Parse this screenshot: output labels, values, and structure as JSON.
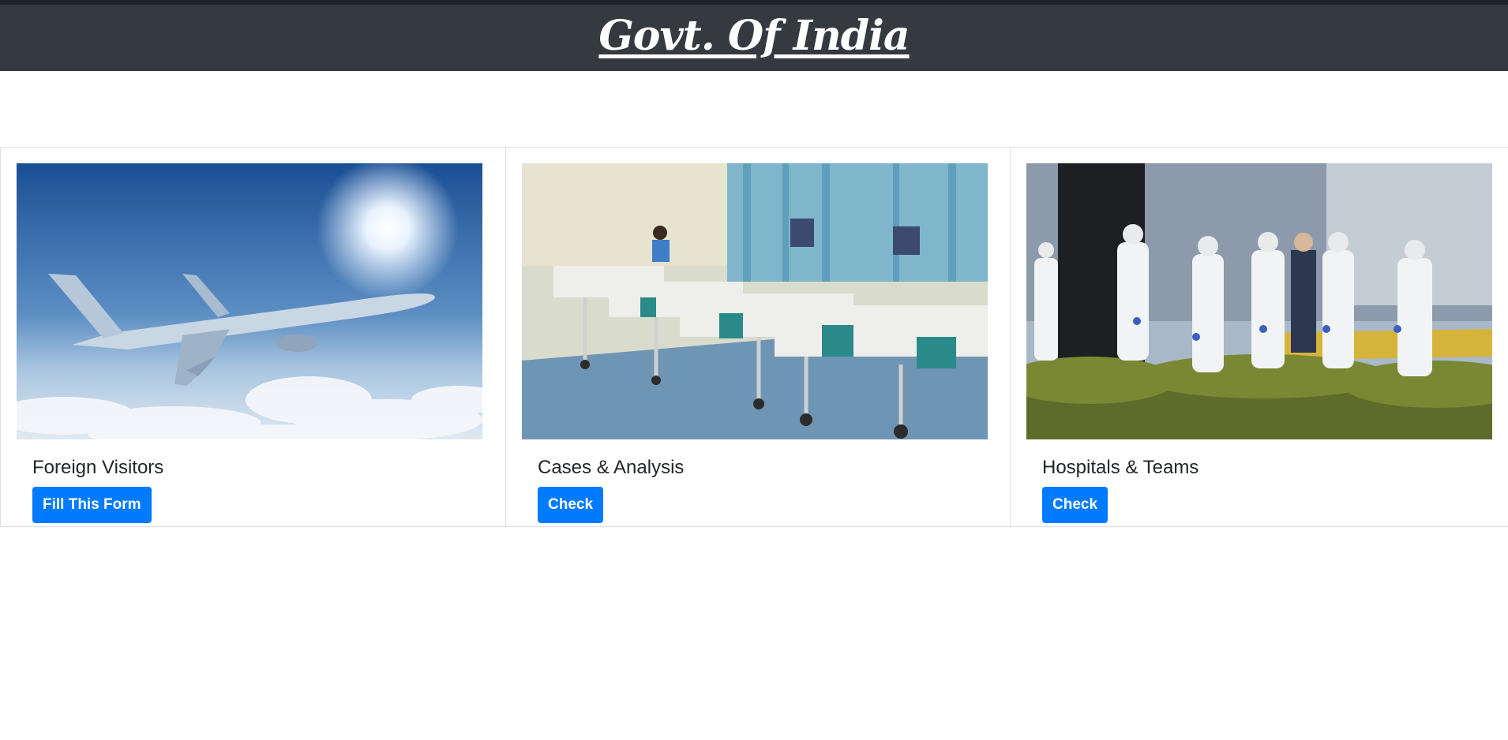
{
  "header": {
    "title": "Govt. Of India",
    "background": "#343a40"
  },
  "cards": [
    {
      "title": "Foreign Visitors",
      "button": "Fill This Form",
      "image": "airplane-image"
    },
    {
      "title": "Cases & Analysis",
      "button": "Check",
      "image": "hospital-ward-image"
    },
    {
      "title": "Hospitals & Teams",
      "button": "Check",
      "image": "medical-team-image"
    }
  ],
  "colors": {
    "button": "#007bff",
    "button_text": "#ffffff"
  }
}
